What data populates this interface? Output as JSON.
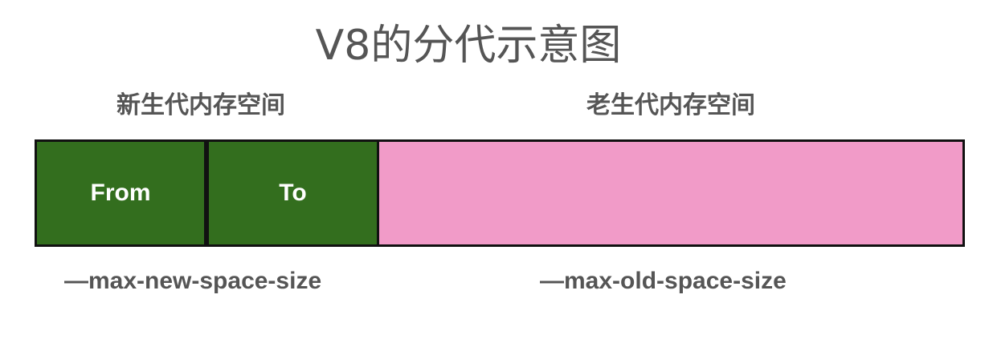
{
  "title": "V8的分代示意图",
  "new_space": {
    "label": "新生代内存空间",
    "flag": "—max-new-space-size",
    "from_label": "From",
    "to_label": "To",
    "color": "#336e1e"
  },
  "old_space": {
    "label": "老生代内存空间",
    "flag": "—max-old-space-size",
    "color": "#f19bc8"
  },
  "border_color": "#111111",
  "text_color": "#555555"
}
